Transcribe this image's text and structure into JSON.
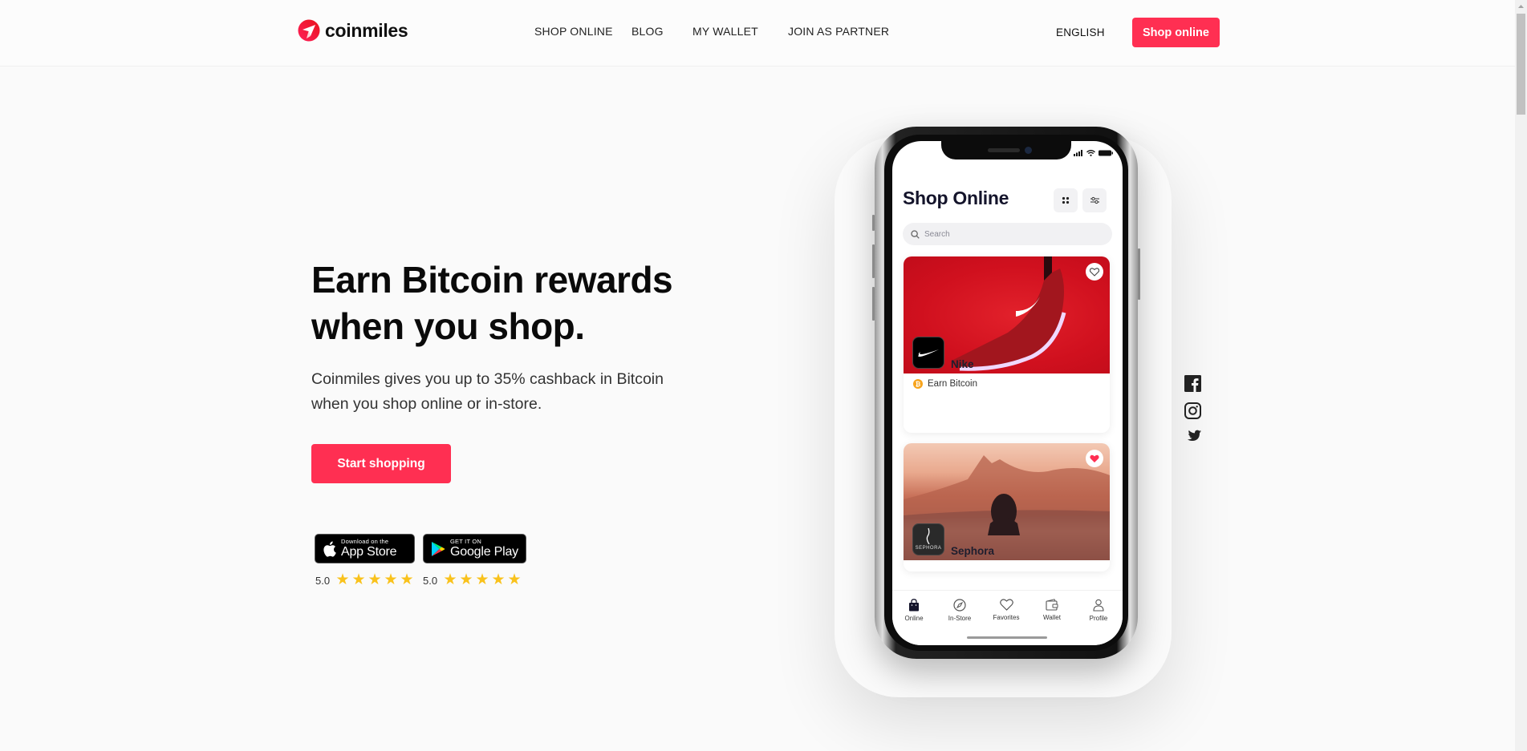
{
  "header": {
    "brand": "coinmiles",
    "nav": [
      {
        "label": "SHOP ONLINE"
      },
      {
        "label": "BLOG"
      },
      {
        "label": "MY WALLET"
      },
      {
        "label": "JOIN AS PARTNER"
      }
    ],
    "language": "ENGLISH",
    "cta_label": "Shop online"
  },
  "hero": {
    "title_line1": "Earn Bitcoin rewards",
    "title_line2": "when you shop.",
    "subtitle_line1": "Coinmiles gives you up to 35% cashback in Bitcoin",
    "subtitle_line2": "when you shop online or in-store.",
    "cta_label": "Start shopping"
  },
  "app_badges": [
    {
      "name": "app-store",
      "small": "Download on the",
      "big": "App Store",
      "rating": "5.0",
      "stars": 5
    },
    {
      "name": "google-play",
      "small": "GET IT ON",
      "big": "Google Play",
      "rating": "5.0",
      "stars": 5
    }
  ],
  "phone": {
    "title": "Shop Online",
    "search_placeholder": "Search",
    "cards": [
      {
        "brand": "Nike",
        "reward": "Earn Bitcoin",
        "favorited": false
      },
      {
        "brand": "Sephora",
        "logo_text": "SEPHORA",
        "favorited": true
      }
    ],
    "tabs": [
      {
        "label": "Online",
        "icon": "shopping-bag-icon",
        "active": true
      },
      {
        "label": "In-Store",
        "icon": "compass-icon",
        "active": false
      },
      {
        "label": "Favorites",
        "icon": "heart-icon",
        "active": false
      },
      {
        "label": "Wallet",
        "icon": "wallet-icon",
        "active": false
      },
      {
        "label": "Profile",
        "icon": "profile-icon",
        "active": false
      }
    ]
  },
  "social": [
    {
      "name": "facebook"
    },
    {
      "name": "instagram"
    },
    {
      "name": "twitter"
    }
  ],
  "colors": {
    "accent": "#ff2f52",
    "star": "#f9c21c",
    "bitcoin": "#f7a41d",
    "nike_bg": "#d0101e"
  }
}
